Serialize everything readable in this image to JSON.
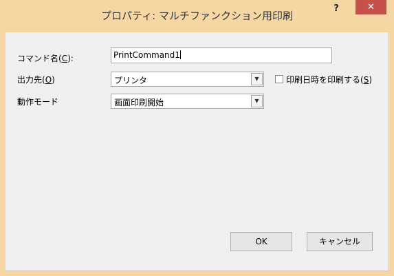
{
  "window": {
    "title": "プロパティ: マルチファンクション用印刷",
    "help_label": "?",
    "close_label": "✕"
  },
  "form": {
    "command_name_label": "コマンド名(",
    "command_name_key": "C",
    "command_name_label_end": "):",
    "command_name_value": "PrintCommand1",
    "output_label": "出力先(",
    "output_key": "O",
    "output_label_end": ")",
    "output_value": "プリンタ",
    "print_datetime_label": "印刷日時を印刷する(",
    "print_datetime_key": "S",
    "print_datetime_label_end": ")",
    "print_datetime_checked": false,
    "operation_mode_label": "動作モード",
    "operation_mode_value": "画面印刷開始"
  },
  "buttons": {
    "ok_label": "OK",
    "cancel_label": "キャンセル"
  },
  "colors": {
    "frame": "#f6d7a4",
    "client": "#f0f0f0",
    "close": "#c7504b"
  }
}
